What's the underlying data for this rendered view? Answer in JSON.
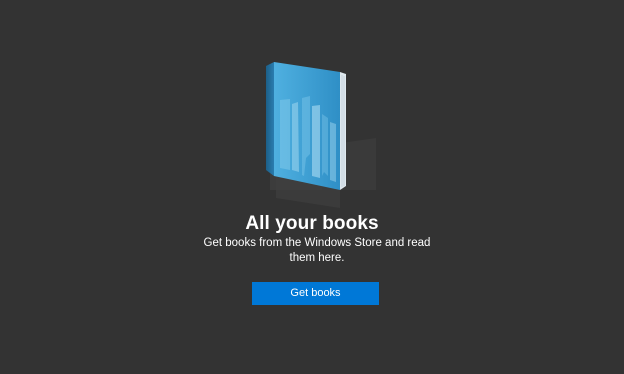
{
  "empty_state": {
    "title": "All your books",
    "description": "Get books from the Windows Store and read them here.",
    "button_label": "Get books",
    "illustration_icon": "book-with-skyline-icon"
  },
  "colors": {
    "background": "#333333",
    "accent": "#0078d7",
    "text": "#ffffff",
    "book_cover": "#3d9ed0",
    "book_spine": "#1f6f9e"
  }
}
